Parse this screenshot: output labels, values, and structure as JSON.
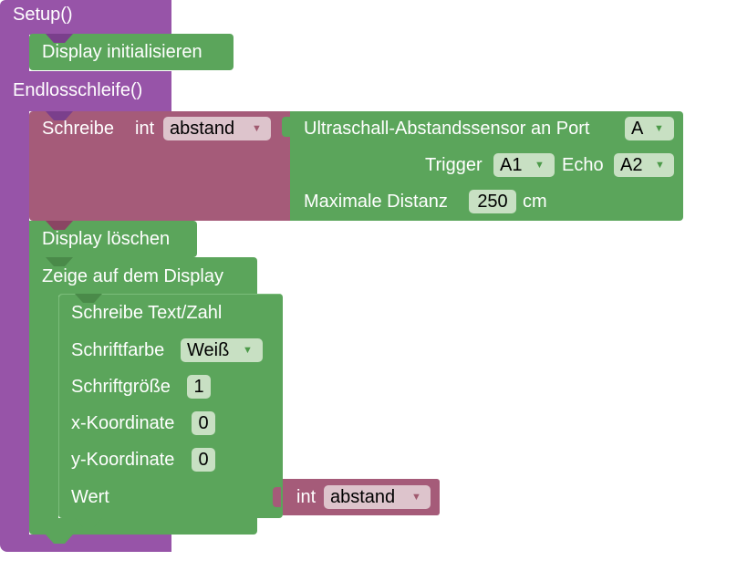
{
  "setup": {
    "label": "Setup()",
    "display_init": "Display initialisieren"
  },
  "loop": {
    "label": "Endlosschleife()",
    "assign": {
      "label": "Schreibe",
      "type": "int",
      "variable": "abstand"
    },
    "sensor": {
      "label": "Ultraschall-Abstandssensor an Port",
      "port": "A",
      "trigger_label": "Trigger",
      "trigger": "A1",
      "echo_label": "Echo",
      "echo": "A2",
      "max_label": "Maximale Distanz",
      "max_value": "250",
      "unit": "cm"
    },
    "display_clear": "Display löschen",
    "show": {
      "label": "Zeige auf dem Display",
      "write": {
        "label": "Schreibe Text/Zahl",
        "color_label": "Schriftfarbe",
        "color": "Weiß",
        "size_label": "Schriftgröße",
        "size": "1",
        "x_label": "x-Koordinate",
        "x": "0",
        "y_label": "y-Koordinate",
        "y": "0",
        "value_label": "Wert",
        "value_type": "int",
        "value_var": "abstand"
      }
    }
  },
  "dropdown_arrow": "▼",
  "colors": {
    "event_purple": "#9754a8",
    "action_green": "#5ba55b",
    "variable_magenta": "#a55b79"
  }
}
